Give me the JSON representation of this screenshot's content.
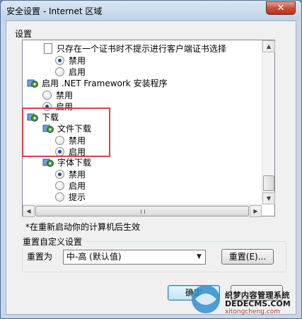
{
  "window": {
    "title": "安全设置 - Internet 区域",
    "close_glyph": "✕"
  },
  "settings_group": {
    "label": "设置",
    "tree": [
      {
        "kind": "doc",
        "label": "只存在一个证书时不提示进行客户端证书选择"
      },
      {
        "kind": "radio",
        "label": "禁用",
        "checked": true
      },
      {
        "kind": "radio",
        "label": "启用",
        "checked": false
      },
      {
        "kind": "gear",
        "label": "启用 .NET Framework 安装程序"
      },
      {
        "kind": "radio",
        "label": "禁用",
        "checked": false
      },
      {
        "kind": "radio",
        "label": "启用",
        "checked": true
      },
      {
        "kind": "gear",
        "label": "下载"
      },
      {
        "kind": "gear",
        "label": "文件下载"
      },
      {
        "kind": "radio",
        "label": "禁用",
        "checked": false
      },
      {
        "kind": "radio",
        "label": "启用",
        "checked": true
      },
      {
        "kind": "gear",
        "label": "字体下载"
      },
      {
        "kind": "radio",
        "label": "禁用",
        "checked": true
      },
      {
        "kind": "radio",
        "label": "启用",
        "checked": false
      },
      {
        "kind": "radio",
        "label": "提示",
        "checked": false
      }
    ],
    "restart_note": "*在重新启动你的计算机后生效"
  },
  "reset_group": {
    "label": "重置自定义设置",
    "reset_to_label": "重置为",
    "selected_value": "中-高 (默认值)",
    "reset_button": "重置(E)..."
  },
  "footer": {
    "ok_button": "确定"
  },
  "watermark": {
    "main": "织梦内容管理系统",
    "domain": "DEDECMS.COM",
    "sub": "xitongcheng.com"
  },
  "colors": {
    "highlight": "#d9434a",
    "selected_radio_dot": "#1f4f8f"
  }
}
